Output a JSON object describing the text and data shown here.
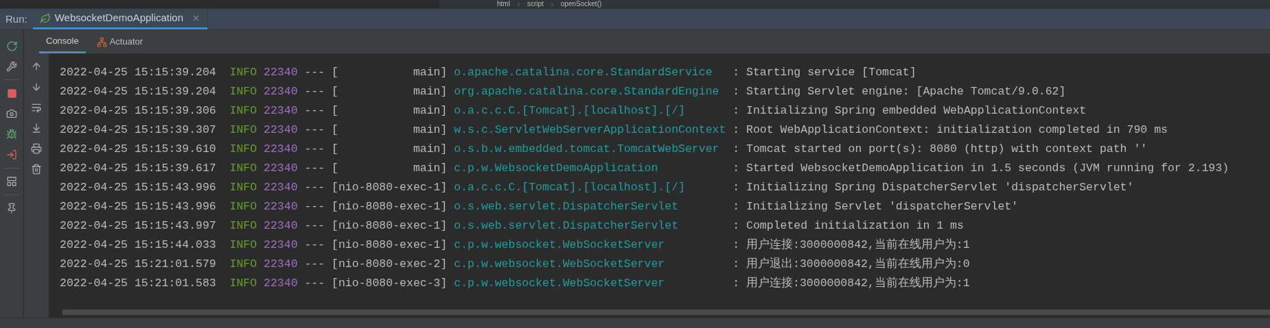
{
  "breadcrumb": [
    "html",
    "script",
    "openSocket()"
  ],
  "run_panel": {
    "label": "Run:",
    "tabs": [
      {
        "title": "WebsocketDemoApplication",
        "selected": true
      }
    ]
  },
  "console_tabs": [
    {
      "label": "Console",
      "selected": true
    },
    {
      "label": "Actuator",
      "selected": false
    }
  ],
  "log_lines": [
    {
      "timestamp": "2022-04-25 15:15:39.204",
      "level": "INFO",
      "pid": "22340",
      "dashes": "---",
      "thread": "[           main]",
      "logger": "o.apache.catalina.core.StandardService",
      "colon": ":",
      "message": "Starting service [Tomcat]"
    },
    {
      "timestamp": "2022-04-25 15:15:39.204",
      "level": "INFO",
      "pid": "22340",
      "dashes": "---",
      "thread": "[           main]",
      "logger": "org.apache.catalina.core.StandardEngine",
      "colon": ":",
      "message": "Starting Servlet engine: [Apache Tomcat/9.0.62]"
    },
    {
      "timestamp": "2022-04-25 15:15:39.306",
      "level": "INFO",
      "pid": "22340",
      "dashes": "---",
      "thread": "[           main]",
      "logger": "o.a.c.c.C.[Tomcat].[localhost].[/]",
      "colon": ":",
      "message": "Initializing Spring embedded WebApplicationContext"
    },
    {
      "timestamp": "2022-04-25 15:15:39.307",
      "level": "INFO",
      "pid": "22340",
      "dashes": "---",
      "thread": "[           main]",
      "logger": "w.s.c.ServletWebServerApplicationContext",
      "colon": ":",
      "message": "Root WebApplicationContext: initialization completed in 790 ms"
    },
    {
      "timestamp": "2022-04-25 15:15:39.610",
      "level": "INFO",
      "pid": "22340",
      "dashes": "---",
      "thread": "[           main]",
      "logger": "o.s.b.w.embedded.tomcat.TomcatWebServer",
      "colon": ":",
      "message": "Tomcat started on port(s): 8080 (http) with context path ''"
    },
    {
      "timestamp": "2022-04-25 15:15:39.617",
      "level": "INFO",
      "pid": "22340",
      "dashes": "---",
      "thread": "[           main]",
      "logger": "c.p.w.WebsocketDemoApplication",
      "colon": ":",
      "message": "Started WebsocketDemoApplication in 1.5 seconds (JVM running for 2.193)"
    },
    {
      "timestamp": "2022-04-25 15:15:43.996",
      "level": "INFO",
      "pid": "22340",
      "dashes": "---",
      "thread": "[nio-8080-exec-1]",
      "logger": "o.a.c.c.C.[Tomcat].[localhost].[/]",
      "colon": ":",
      "message": "Initializing Spring DispatcherServlet 'dispatcherServlet'"
    },
    {
      "timestamp": "2022-04-25 15:15:43.996",
      "level": "INFO",
      "pid": "22340",
      "dashes": "---",
      "thread": "[nio-8080-exec-1]",
      "logger": "o.s.web.servlet.DispatcherServlet",
      "colon": ":",
      "message": "Initializing Servlet 'dispatcherServlet'"
    },
    {
      "timestamp": "2022-04-25 15:15:43.997",
      "level": "INFO",
      "pid": "22340",
      "dashes": "---",
      "thread": "[nio-8080-exec-1]",
      "logger": "o.s.web.servlet.DispatcherServlet",
      "colon": ":",
      "message": "Completed initialization in 1 ms"
    },
    {
      "timestamp": "2022-04-25 15:15:44.033",
      "level": "INFO",
      "pid": "22340",
      "dashes": "---",
      "thread": "[nio-8080-exec-1]",
      "logger": "c.p.w.websocket.WebSocketServer",
      "colon": ":",
      "message": "用户连接:3000000842,当前在线用户为:1"
    },
    {
      "timestamp": "2022-04-25 15:21:01.579",
      "level": "INFO",
      "pid": "22340",
      "dashes": "---",
      "thread": "[nio-8080-exec-2]",
      "logger": "c.p.w.websocket.WebSocketServer",
      "colon": ":",
      "message": "用户退出:3000000842,当前在线用户为:0"
    },
    {
      "timestamp": "2022-04-25 15:21:01.583",
      "level": "INFO",
      "pid": "22340",
      "dashes": "---",
      "thread": "[nio-8080-exec-3]",
      "logger": "c.p.w.websocket.WebSocketServer",
      "colon": ":",
      "message": "用户连接:3000000842,当前在线用户为:1"
    }
  ]
}
